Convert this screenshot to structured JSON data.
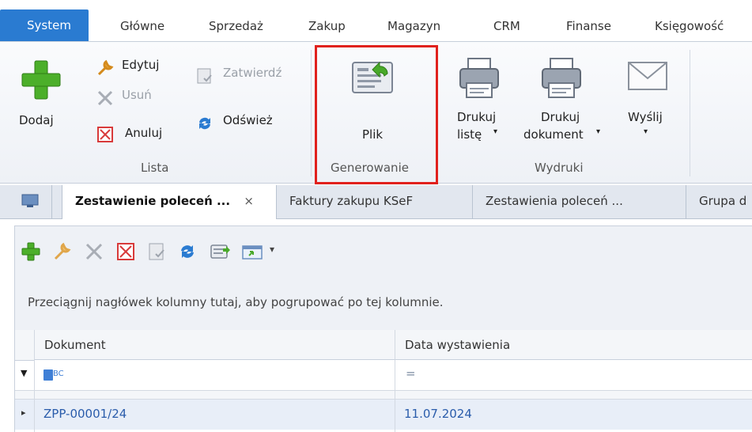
{
  "menu": {
    "tabs": [
      "System",
      "Główne",
      "Sprzedaż",
      "Zakup",
      "Magazyn",
      "CRM",
      "Finanse",
      "Księgowość"
    ]
  },
  "ribbon": {
    "lista": {
      "dodaj": "Dodaj",
      "edytuj": "Edytuj",
      "usun": "Usuń",
      "anuluj": "Anuluj",
      "zatwierdz": "Zatwierdź",
      "odswiez": "Odśwież",
      "group_label": "Lista"
    },
    "generowanie": {
      "plik": "Plik",
      "group_label": "Generowanie"
    },
    "wydruki": {
      "drukuj_liste_1": "Drukuj",
      "drukuj_liste_2": "listę",
      "drukuj_dokument_1": "Drukuj",
      "drukuj_dokument_2": "dokument",
      "wyslij": "Wyślij",
      "group_label": "Wydruki"
    },
    "accent_color": "#2a7bd1",
    "highlight_color": "#e0211d"
  },
  "doc_tabs": [
    {
      "label": "Zestawienie poleceń ...",
      "close": "×",
      "active": true
    },
    {
      "label": "Faktury zakupu KSeF",
      "active": false
    },
    {
      "label": "Zestawienia poleceń ...",
      "active": false
    },
    {
      "label": "Grupa d",
      "active": false
    }
  ],
  "grid": {
    "group_hint": "Przeciągnij nagłówek kolumny tutaj, aby pogrupować po tej kolumnie.",
    "columns": [
      "Dokument",
      "Data wystawienia"
    ],
    "filter_row": {
      "abc_icon_text": "BC",
      "equals": "="
    },
    "rows": [
      {
        "dokument": "ZPP-00001/24",
        "data": "11.07.2024"
      }
    ]
  }
}
